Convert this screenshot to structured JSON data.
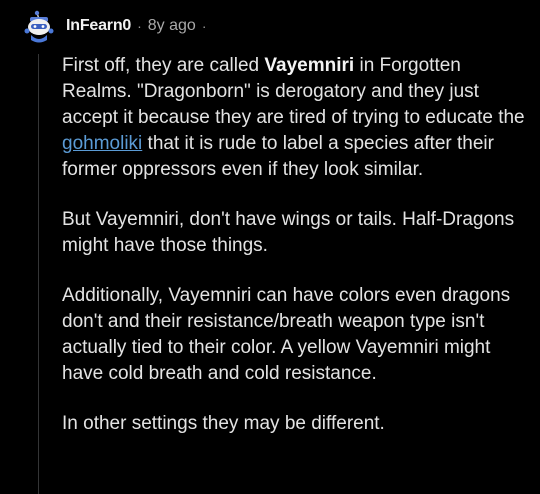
{
  "comment": {
    "author": "InFearn0",
    "separator": "·",
    "age": "8y ago",
    "trailing_separator": "·",
    "avatar_icon": "snoo-avatar-icon",
    "paragraph1": {
      "part1": "First off, they are called ",
      "bold1": "Vayemniri",
      "part2": " in Forgotten Realms. \"Dragonborn\" is derogatory and they just accept it because they are tired of trying to educate the ",
      "link_text": "gohmoliki",
      "part3": " that it is rude to label a species after their former oppressors even if they look similar."
    },
    "paragraph2": "But Vayemniri, don't have wings or tails. Half-Dragons might have those things.",
    "paragraph3": "Additionally, Vayemniri can have colors even dragons don't and their resistance/breath weapon type isn't actually tied to their color. A yellow Vayemniri might have cold breath and cold resistance.",
    "paragraph4": "In other settings they may be different.",
    "colors": {
      "background": "#000000",
      "text": "#e3e3e3",
      "link": "#5b9bd5",
      "avatar_bg": "#4a78d8"
    }
  }
}
